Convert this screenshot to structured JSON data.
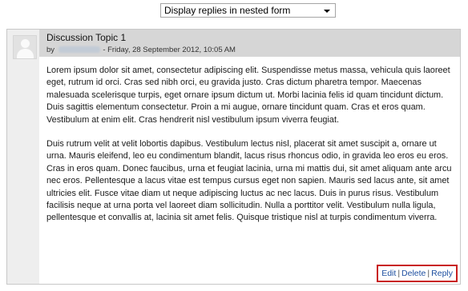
{
  "display_mode": {
    "selected": "Display replies in nested form"
  },
  "post": {
    "subject": "Discussion Topic 1",
    "by_label": "by",
    "date_text": "- Friday, 28 September 2012, 10:05 AM",
    "paragraphs": [
      "Lorem ipsum dolor sit amet, consectetur adipiscing elit. Suspendisse metus massa, vehicula quis laoreet eget, rutrum id orci. Cras sed nibh orci, eu gravida justo. Cras dictum pharetra tempor. Maecenas malesuada scelerisque turpis, eget ornare ipsum dictum ut. Morbi lacinia felis id quam tincidunt dictum. Duis sagittis elementum consectetur. Proin a mi augue, ornare tincidunt quam. Cras et eros quam. Vestibulum at enim elit. Cras hendrerit nisl vestibulum ipsum viverra feugiat.",
      "Duis rutrum velit at velit lobortis dapibus. Vestibulum lectus nisl, placerat sit amet suscipit a, ornare ut urna. Mauris eleifend, leo eu condimentum blandit, lacus risus rhoncus odio, in gravida leo eros eu eros. Cras in eros quam. Donec faucibus, urna et feugiat lacinia, urna mi mattis dui, sit amet aliquam ante arcu nec eros. Pellentesque a lacus vitae est tempus cursus eget non sapien. Mauris sed lacus ante, sit amet ultricies elit. Fusce vitae diam ut neque adipiscing luctus ac nec lacus. Duis in purus risus. Vestibulum facilisis neque at urna porta vel laoreet diam sollicitudin. Nulla a porttitor velit. Vestibulum nulla ligula, pellentesque et convallis at, lacinia sit amet felis. Quisque tristique nisl at turpis condimentum viverra."
    ],
    "commands": {
      "edit": "Edit",
      "delete": "Delete",
      "reply": "Reply",
      "separator": "|"
    }
  },
  "colors": {
    "header_bg": "#d6d6d6",
    "link": "#1f4fa0",
    "highlight_border": "#c81e1e"
  }
}
